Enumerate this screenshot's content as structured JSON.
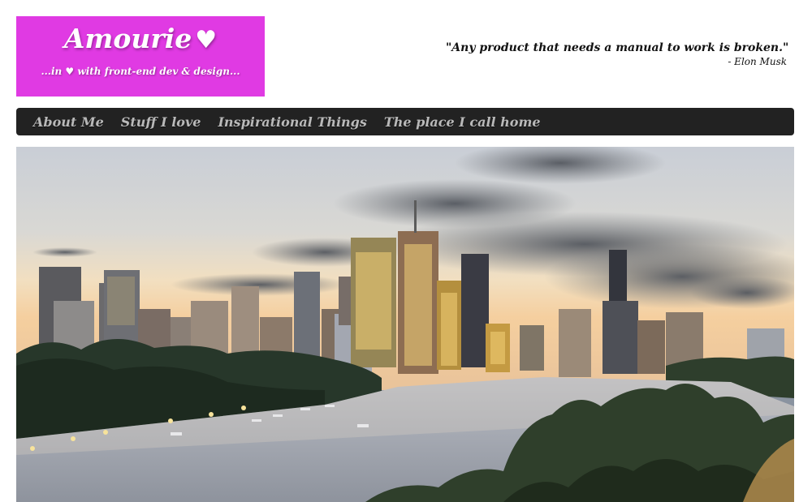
{
  "logo": {
    "title": "Amourie",
    "heart": "♥",
    "tagline": "...in ♥ with front-end dev & design..."
  },
  "quote": {
    "text": "\"Any product that needs a manual to work is broken.\"",
    "author": "- Elon Musk"
  },
  "nav": {
    "items": [
      {
        "label": "About Me"
      },
      {
        "label": "Stuff I love"
      },
      {
        "label": "Inspirational Things"
      },
      {
        "label": "The place I call home"
      }
    ]
  },
  "colors": {
    "brand": "#e03ae3",
    "navbar": "#222222",
    "nav_text": "#b9b9b9"
  },
  "hero": {
    "subject": "city-skyline-river-dusk-photo"
  }
}
